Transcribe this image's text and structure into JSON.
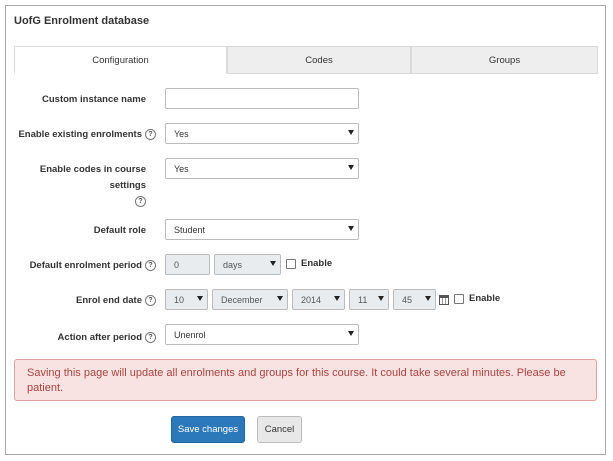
{
  "page": {
    "title": "UofG Enrolment database"
  },
  "tabs": [
    {
      "label": "Configuration",
      "active": true
    },
    {
      "label": "Codes",
      "active": false
    },
    {
      "label": "Groups",
      "active": false
    }
  ],
  "form": {
    "instance_name": {
      "label": "Custom instance name",
      "value": ""
    },
    "existing_enrolments": {
      "label": "Enable existing enrolments",
      "value": "Yes"
    },
    "codes_in_settings": {
      "label_line1": "Enable codes in course",
      "label_line2": "settings",
      "value": "Yes"
    },
    "default_role": {
      "label": "Default role",
      "value": "Student"
    },
    "enrolment_period": {
      "label": "Default enrolment period",
      "number": "0",
      "unit": "days",
      "enable_label": "Enable"
    },
    "end_date": {
      "label": "Enrol end date",
      "day": "10",
      "month": "December",
      "year": "2014",
      "hour": "11",
      "minute": "45",
      "enable_label": "Enable"
    },
    "action_after_period": {
      "label": "Action after period",
      "value": "Unenrol"
    }
  },
  "help_icon_glyph": "?",
  "alert": {
    "text": "Saving this page will update all enrolments and groups for this course. It could take several minutes. Please be patient."
  },
  "buttons": {
    "save": "Save changes",
    "cancel": "Cancel"
  },
  "colors": {
    "primary": "#2b78bb",
    "alert_bg": "#f9e3e2",
    "alert_text": "#a94442"
  }
}
